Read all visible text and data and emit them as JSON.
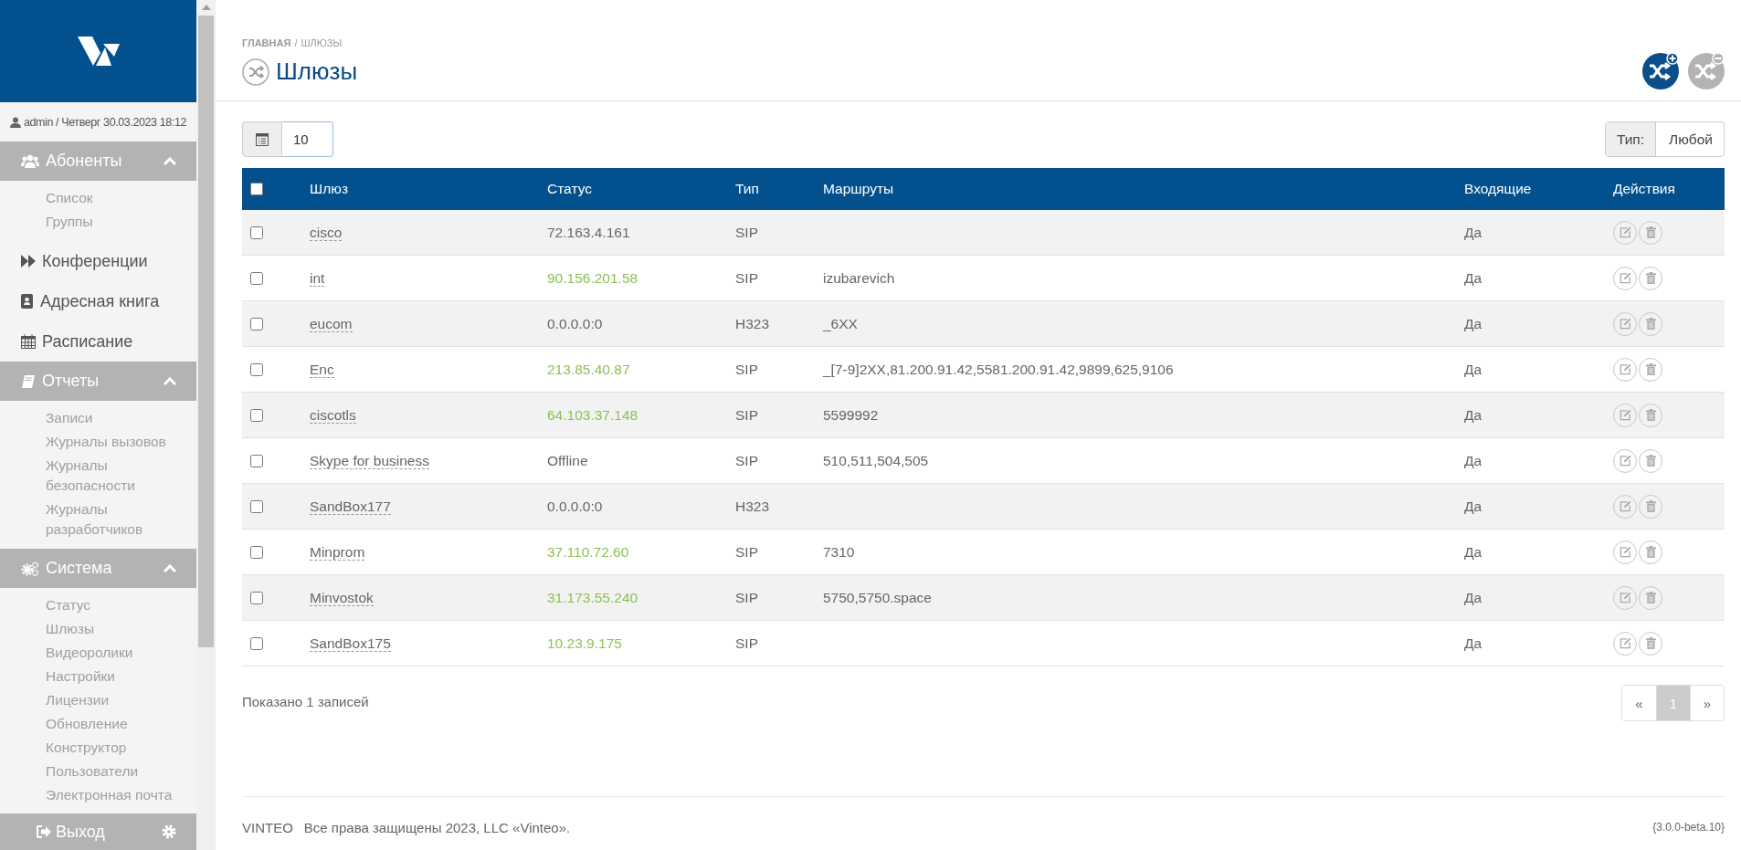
{
  "sidebar": {
    "user": "admin / Четверг 30.03.2023 18:12",
    "sections": [
      {
        "kind": "group",
        "label": "Абоненты",
        "expanded": true,
        "children": [
          {
            "label": "Список"
          },
          {
            "label": "Группы"
          }
        ]
      },
      {
        "kind": "link",
        "label": "Конференции"
      },
      {
        "kind": "link",
        "label": "Адресная книга"
      },
      {
        "kind": "link",
        "label": "Расписание"
      },
      {
        "kind": "group",
        "label": "Отчеты",
        "expanded": true,
        "children": [
          {
            "label": "Записи"
          },
          {
            "label": "Журналы вызовов"
          },
          {
            "label": "Журналы безопасности"
          },
          {
            "label": "Журналы разработчиков"
          }
        ]
      },
      {
        "kind": "group",
        "label": "Система",
        "expanded": true,
        "children": [
          {
            "label": "Статус"
          },
          {
            "label": "Шлюзы"
          },
          {
            "label": "Видеоролики"
          },
          {
            "label": "Настройки"
          },
          {
            "label": "Лицензии"
          },
          {
            "label": "Обновление"
          },
          {
            "label": "Конструктор"
          },
          {
            "label": "Пользователи"
          },
          {
            "label": "Электронная почта"
          }
        ]
      }
    ],
    "logout": "Выход"
  },
  "breadcrumb": {
    "items": [
      "ГЛАВНАЯ",
      "ШЛЮЗЫ"
    ],
    "separator": "/"
  },
  "page_title": "Шлюзы",
  "header_actions": [
    {
      "kind": "add",
      "disabled": false
    },
    {
      "kind": "remove",
      "disabled": true
    }
  ],
  "page_size": "10",
  "filter": {
    "label": "Тип:",
    "value": "Любой"
  },
  "table": {
    "all_checked": false,
    "columns": [
      "Шлюз",
      "Статус",
      "Тип",
      "Маршруты",
      "Входящие",
      "Действия"
    ],
    "rows": [
      {
        "checked": false,
        "name": "cisco",
        "status": "72.163.4.161",
        "online": false,
        "type": "SIP",
        "incoming": "Да"
      },
      {
        "checked": false,
        "name": "int",
        "status": "90.156.201.58",
        "online": true,
        "type": "SIP",
        "routes": "izubarevich",
        "incoming": "Да"
      },
      {
        "checked": false,
        "name": "eucom",
        "status": "0.0.0.0:0",
        "online": false,
        "type": "H323",
        "routes": "_6XX",
        "incoming": "Да"
      },
      {
        "checked": false,
        "name": "Enc",
        "status": "213.85.40.87",
        "online": true,
        "type": "SIP",
        "routes": "_[7-9]2XX,81.200.91.42,5581.200.91.42,9899,625,9106",
        "incoming": "Да"
      },
      {
        "checked": false,
        "name": "ciscotls",
        "status": "64.103.37.148",
        "online": true,
        "type": "SIP",
        "routes": "5599992",
        "incoming": "Да"
      },
      {
        "checked": false,
        "name": "Skype for business",
        "status": "Offline",
        "online": false,
        "type": "SIP",
        "routes": "510,511,504,505",
        "incoming": "Да"
      },
      {
        "checked": false,
        "name": "SandBox177",
        "status": "0.0.0.0:0",
        "online": false,
        "type": "H323",
        "incoming": "Да"
      },
      {
        "checked": false,
        "name": "Minprom",
        "status": "37.110.72.60",
        "online": true,
        "type": "SIP",
        "routes": "7310",
        "incoming": "Да"
      },
      {
        "checked": false,
        "name": "Minvostok",
        "status": "31.173.55.240",
        "online": true,
        "type": "SIP",
        "routes": "5750,5750.space",
        "incoming": "Да"
      },
      {
        "checked": false,
        "name": "SandBox175",
        "status": "10.23.9.175",
        "online": true,
        "type": "SIP",
        "incoming": "Да"
      }
    ]
  },
  "summary": "Показано 1 записей",
  "pagination": [
    {
      "label": "«",
      "selected": false
    },
    {
      "label": "1",
      "selected": true
    },
    {
      "label": "»",
      "selected": false
    }
  ],
  "footer": {
    "brand": "VINTEO",
    "copyright": "Все права защищены 2023, LLC «Vinteo».",
    "version": "{3.0.0-beta.10}"
  }
}
